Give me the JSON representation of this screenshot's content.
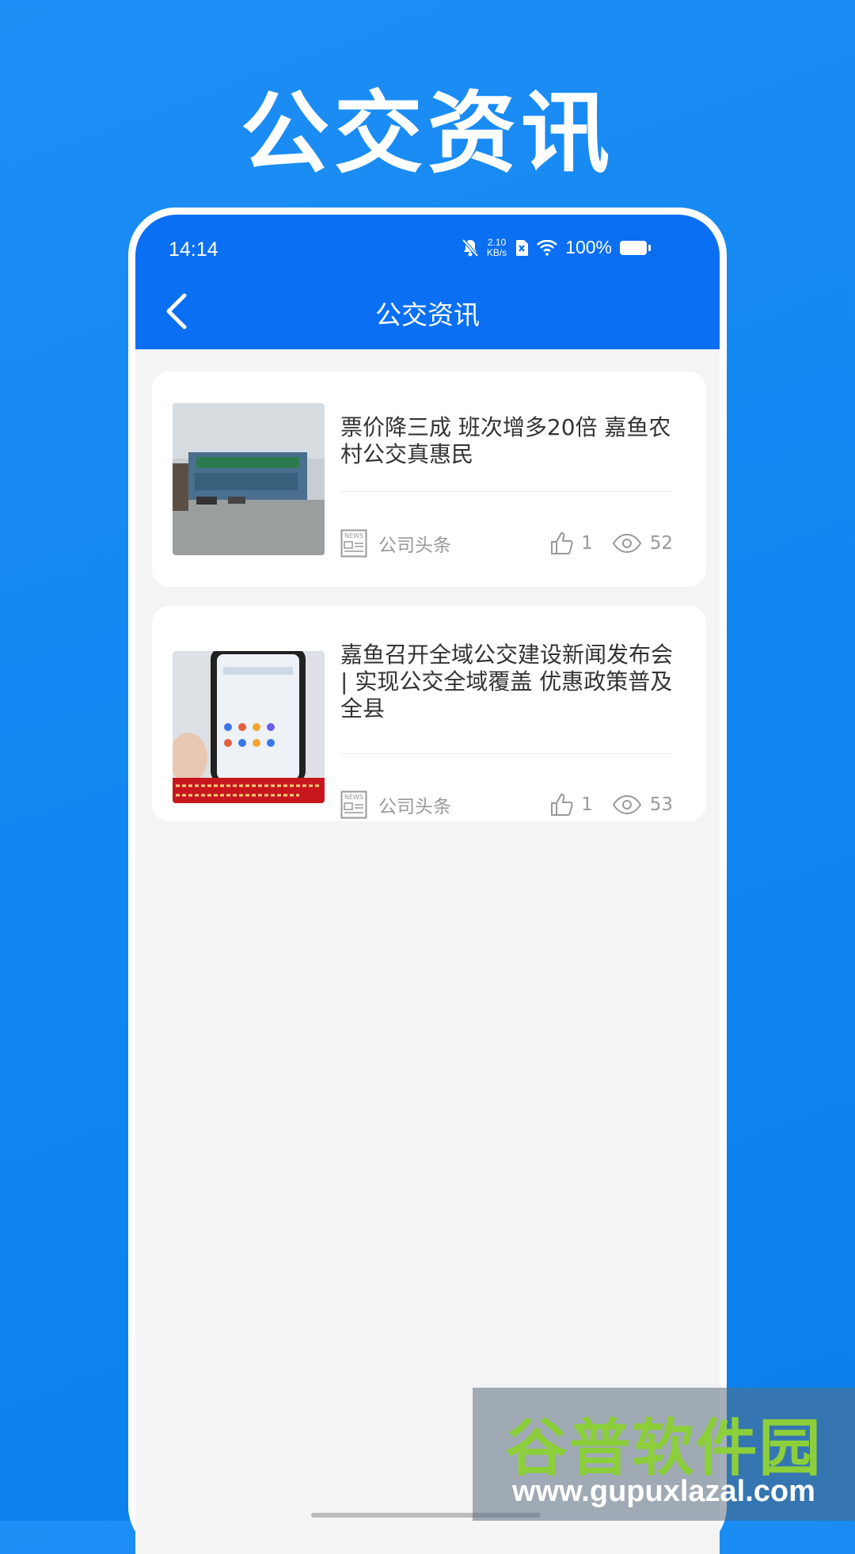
{
  "hero": {
    "title": "公交资讯"
  },
  "status_bar": {
    "time": "14:14",
    "net_speed_value": "2.10",
    "net_speed_unit": "KB/s",
    "battery": "100%"
  },
  "nav": {
    "title": "公交资讯"
  },
  "articles": [
    {
      "title": "票价降三成 班次增多20倍 嘉鱼农村公交真惠民",
      "category": "公司头条",
      "likes": "1",
      "views": "52"
    },
    {
      "title": "嘉鱼召开全域公交建设新闻发布会 | 实现公交全域覆盖 优惠政策普及全县",
      "category": "公司头条",
      "likes": "1",
      "views": "53"
    }
  ],
  "watermark": {
    "name": "谷普软件园",
    "url": "www.gupuxlazal.com"
  },
  "colors": {
    "background": "#1a8cf5",
    "appbar": "#0a6ff3",
    "card": "#ffffff"
  }
}
